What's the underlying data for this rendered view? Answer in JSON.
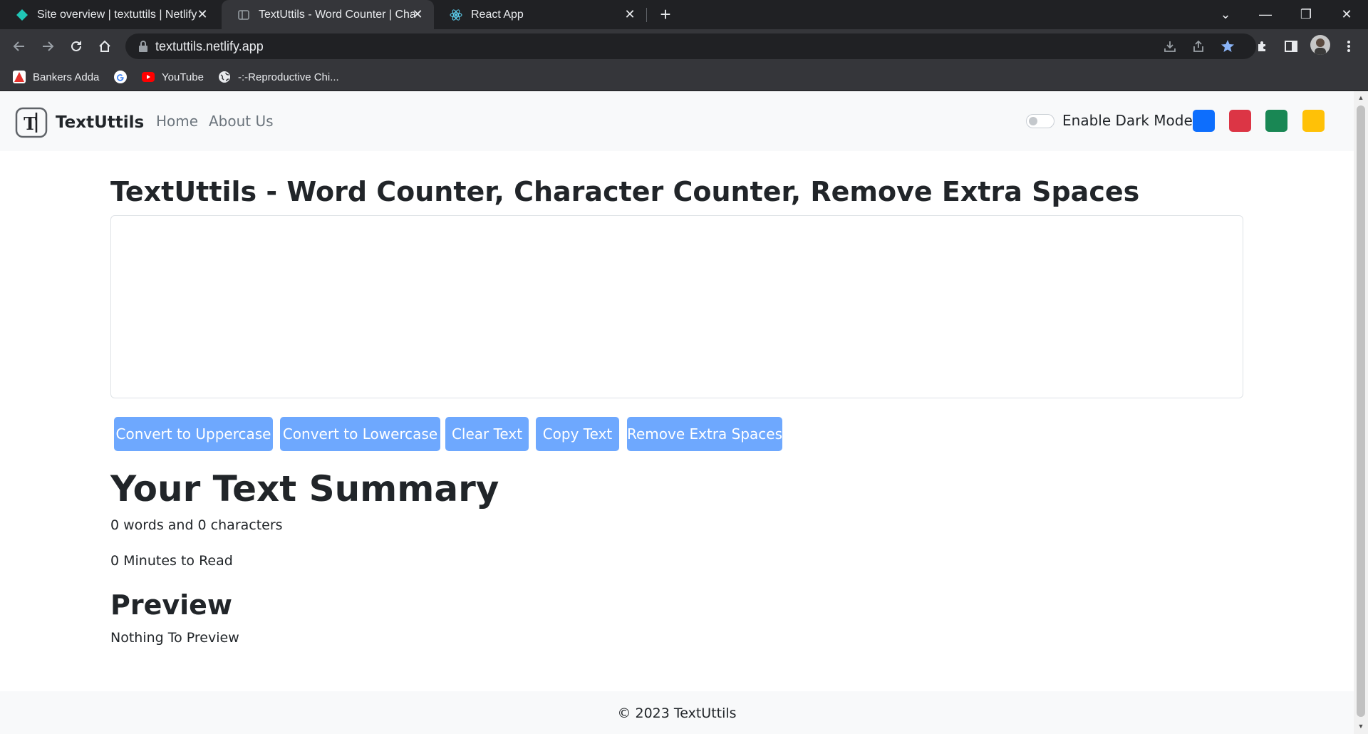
{
  "browser": {
    "tabs": [
      {
        "title": "Site overview | textuttils | Netlify",
        "icon": "netlify-icon",
        "active": false
      },
      {
        "title": "TextUttils - Word Counter | Chara",
        "icon": "page-icon",
        "active": true
      },
      {
        "title": "React App",
        "icon": "react-icon",
        "active": false
      }
    ],
    "new_tab": "+",
    "url": "textuttils.netlify.app",
    "bookmarks": [
      {
        "label": "Bankers Adda",
        "icon": "bankers-adda-icon"
      },
      {
        "label": "",
        "icon": "google-icon"
      },
      {
        "label": "YouTube",
        "icon": "youtube-icon"
      },
      {
        "label": "-:-Reproductive Chi...",
        "icon": "globe-icon"
      }
    ]
  },
  "navbar": {
    "brand": "TextUttils",
    "brand_logo_letter": "T",
    "links": [
      "Home",
      "About Us"
    ],
    "dark_mode_label": "Enable Dark Mode",
    "dark_mode_enabled": false,
    "color_swatches": [
      "#0d6efd",
      "#dc3545",
      "#198754",
      "#ffc107"
    ]
  },
  "main": {
    "heading": "TextUttils - Word Counter, Character Counter, Remove Extra Spaces",
    "textarea_value": "",
    "buttons": [
      "Convert to Uppercase",
      "Convert to Lowercase",
      "Clear Text",
      "Copy Text",
      "Remove Extra Spaces"
    ],
    "button_color": "#6ea8fe",
    "summary_heading": "Your Text Summary",
    "word_char_count": "0 words and 0 characters",
    "read_time": "0 Minutes to Read",
    "preview_heading": "Preview",
    "preview_text": "Nothing To Preview"
  },
  "footer": {
    "text": "© 2023 TextUttils"
  }
}
